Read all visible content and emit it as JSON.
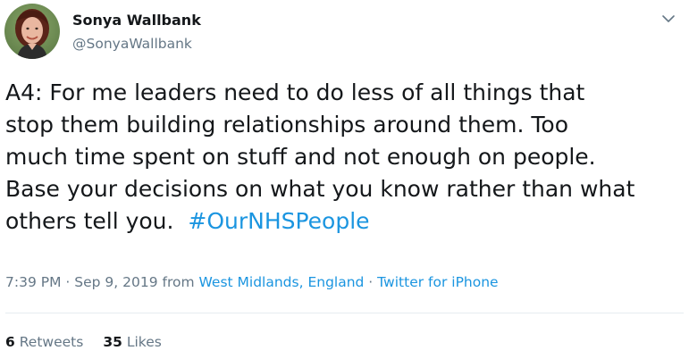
{
  "user": {
    "display_name": "Sonya Wallbank",
    "screen_name": "@SonyaWallbank",
    "avatar_icon": "profile-photo"
  },
  "tweet": {
    "lines": [
      "A4: For me leaders need to do less of all things that",
      "stop them building relationships around them. Too",
      "much time spent on stuff and not enough on people.",
      "Base your decisions on what you know rather than what"
    ],
    "last_line_text": "others tell you.  ",
    "hashtag": "#OurNHSPeople"
  },
  "meta": {
    "time": "7:39 PM",
    "sep1": " · ",
    "date": "Sep 9, 2019",
    "from": " from ",
    "location": "West Midlands, England",
    "sep2": " · ",
    "client": "Twitter for iPhone"
  },
  "stats": {
    "retweets_count": "6",
    "retweets_label": " Retweets",
    "likes_count": "35",
    "likes_label": " Likes"
  },
  "colors": {
    "link": "#1b95e0",
    "text": "#14171a",
    "muted": "#657786",
    "divider": "#e6ecf0"
  },
  "icons": {
    "menu": "chevron-down-icon"
  }
}
